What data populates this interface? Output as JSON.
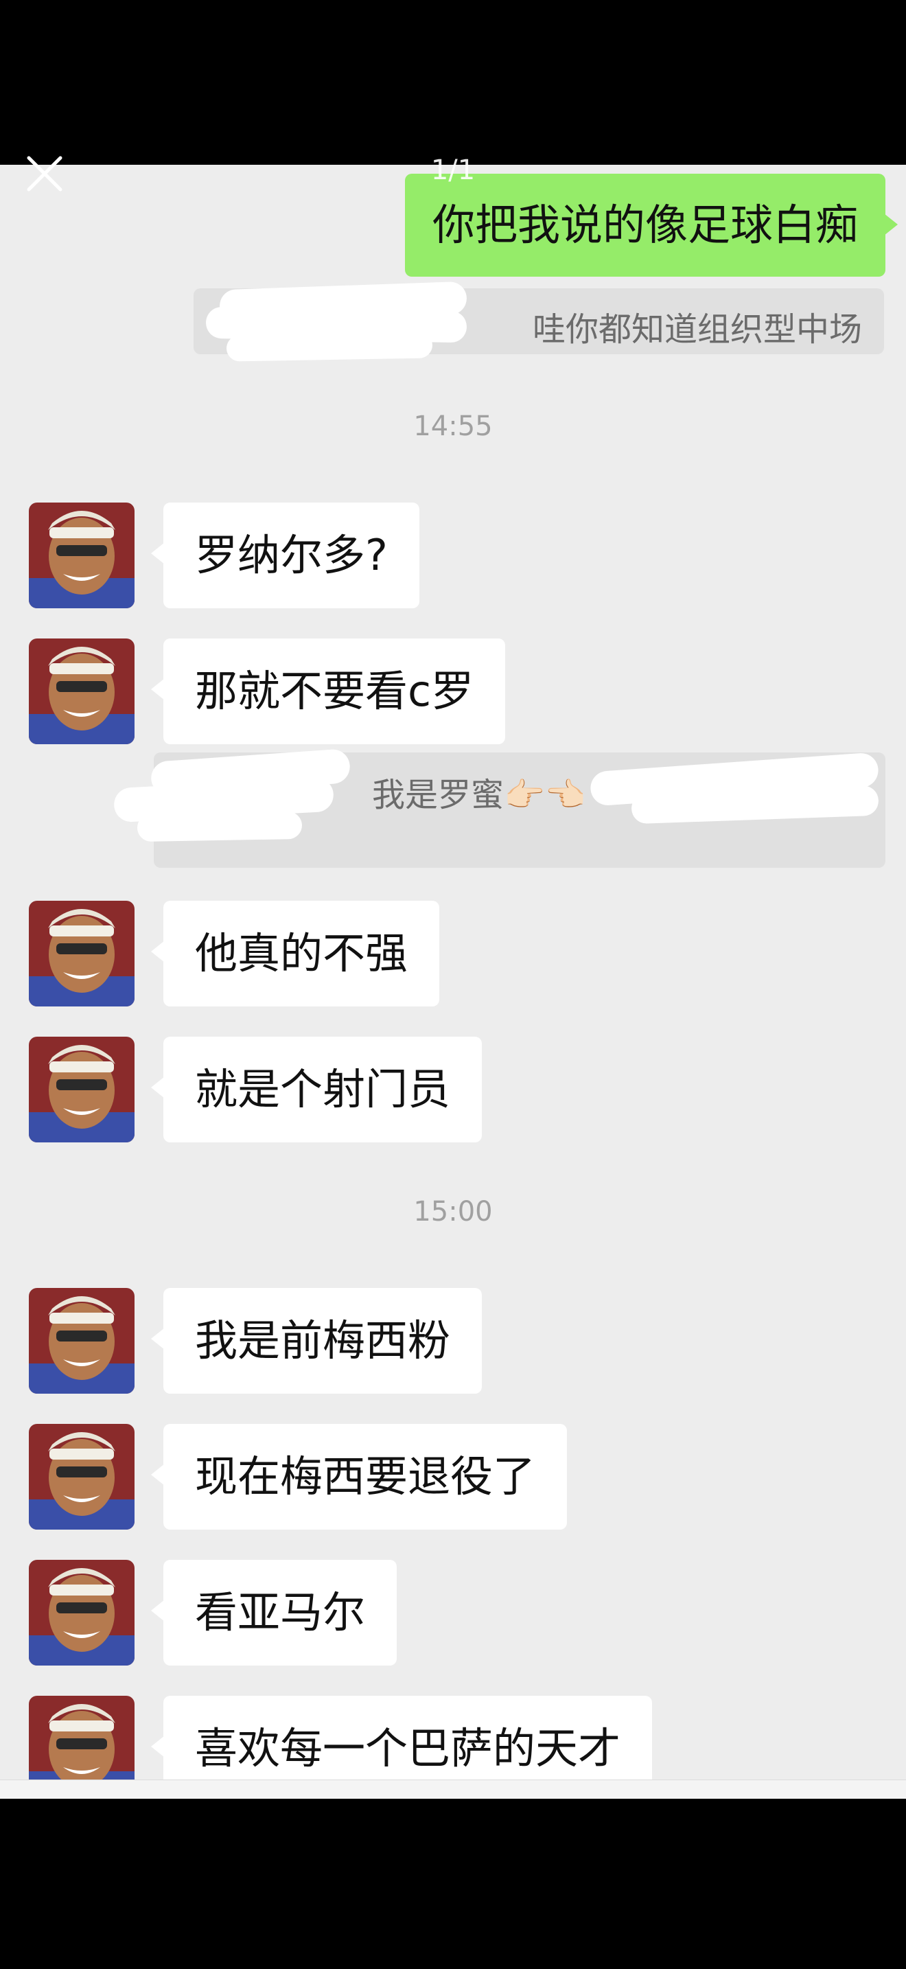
{
  "viewer": {
    "page_indicator": "1/1"
  },
  "messages": {
    "sent_1": "你把我说的像足球白痴",
    "quote_1": "哇你都知道组织型中场",
    "time_1": "14:55",
    "recv_1": "罗纳尔多?",
    "recv_2": "那就不要看c罗",
    "quote_2": "我是罗蜜👉🏻👈🏻",
    "recv_3": "他真的不强",
    "recv_4": "就是个射门员",
    "time_2": "15:00",
    "recv_5": "我是前梅西粉",
    "recv_6": "现在梅西要退役了",
    "recv_7": "看亚马尔",
    "recv_8": "喜欢每一个巴萨的天才"
  },
  "colors": {
    "sent_bubble": "#95ec69",
    "received_bubble": "#ffffff",
    "chat_background": "#ededed",
    "quote_background": "#e0e0e0"
  },
  "icons": {
    "close": "close-icon",
    "avatar": "avatar-image"
  }
}
